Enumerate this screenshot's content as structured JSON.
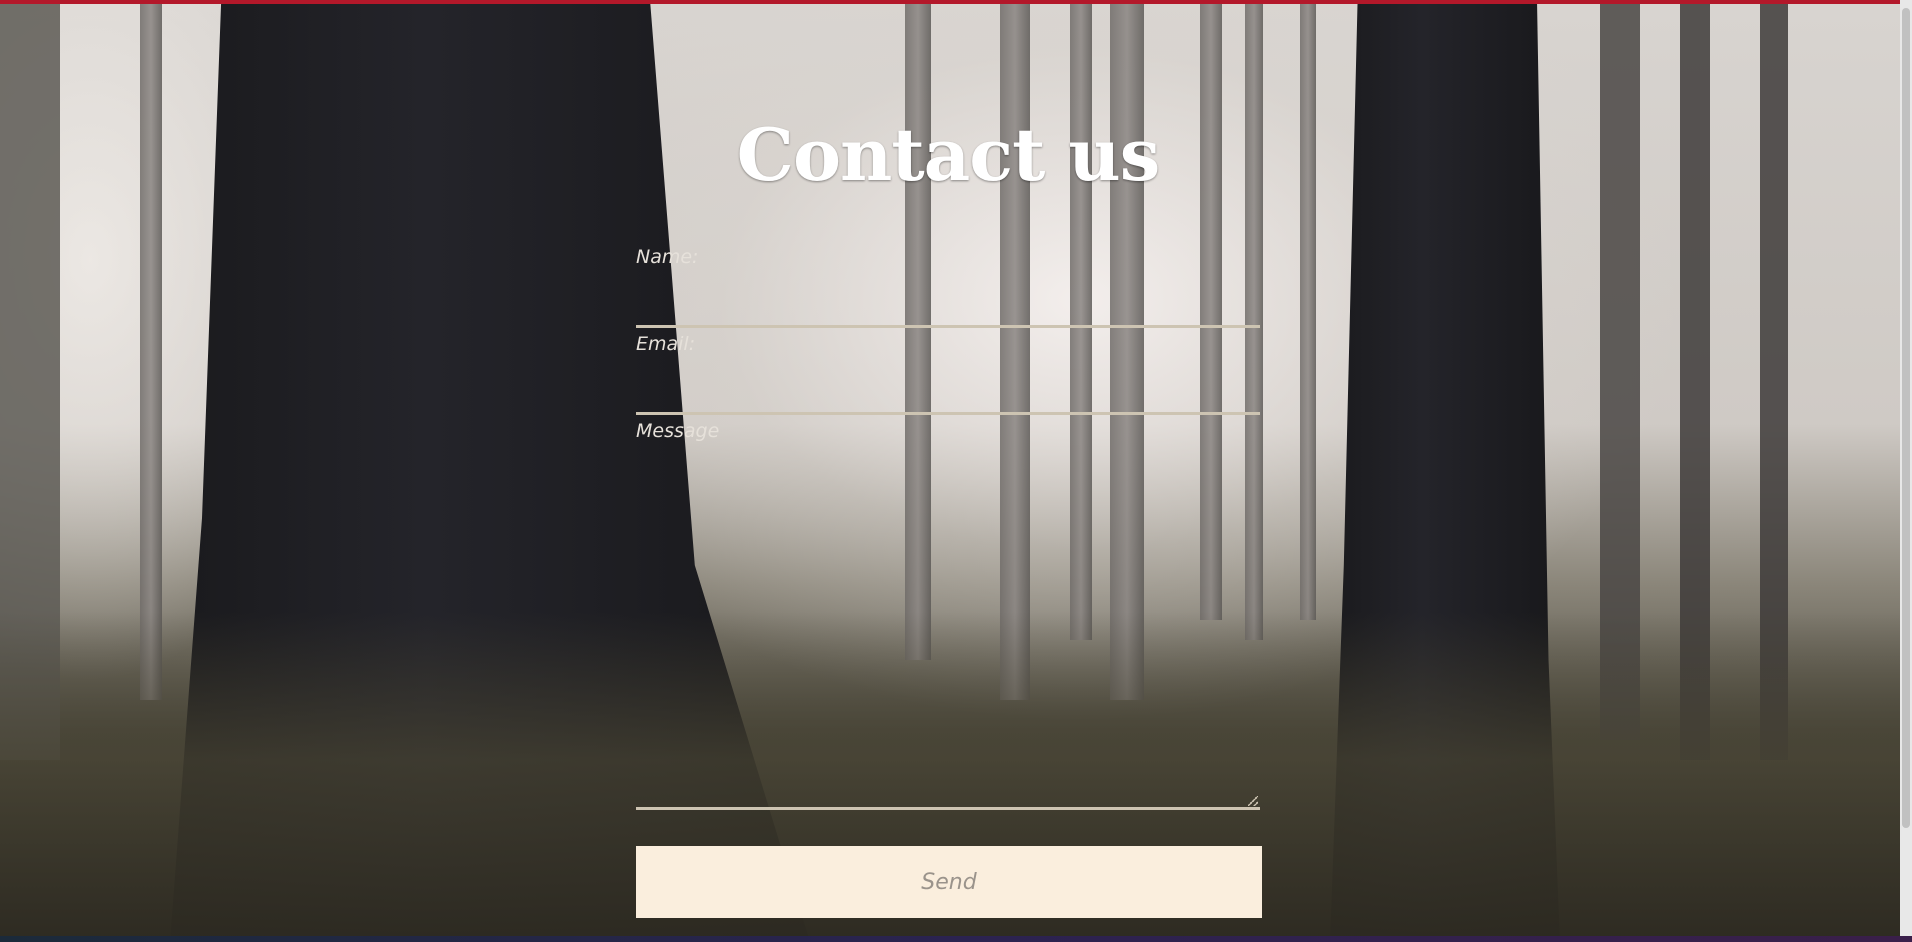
{
  "page": {
    "title": "Contact us"
  },
  "form": {
    "name_label": "Name:",
    "email_label": "Email:",
    "message_label": "Message",
    "name_value": "",
    "email_value": "",
    "message_value": "",
    "send_label": "Send"
  },
  "colors": {
    "accent_top": "#b3182a",
    "button_bg": "#faeedd",
    "underline": "#cdc4b2"
  }
}
